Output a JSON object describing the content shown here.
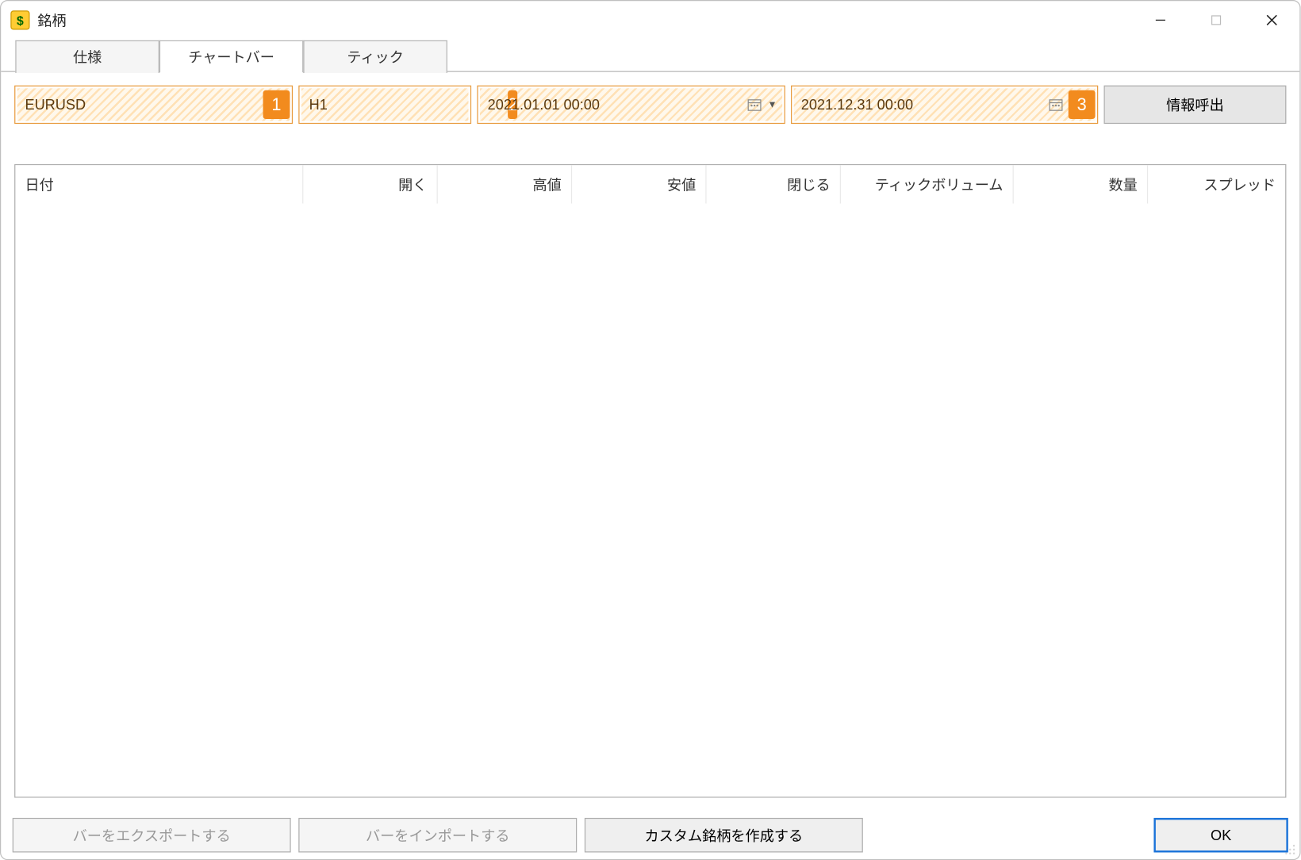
{
  "window": {
    "title": "銘柄"
  },
  "tabs": {
    "spec": "仕様",
    "bars": "チャートバー",
    "ticks": "ティック"
  },
  "toolbar": {
    "symbol": "EURUSD",
    "timeframe": "H1",
    "from_date": "2021.01.01 00:00",
    "to_date": "2021.12.31 00:00",
    "request_label": "情報呼出",
    "badge1": "1",
    "badge2": "2",
    "badge3": "3"
  },
  "grid": {
    "columns": {
      "date": "日付",
      "open": "開く",
      "high": "高値",
      "low": "安値",
      "close": "閉じる",
      "tick_vol": "ティックボリューム",
      "volume": "数量",
      "spread": "スプレッド"
    }
  },
  "footer": {
    "export_bars": "バーをエクスポートする",
    "import_bars": "バーをインポートする",
    "create_custom": "カスタム銘柄を作成する",
    "ok": "OK"
  }
}
